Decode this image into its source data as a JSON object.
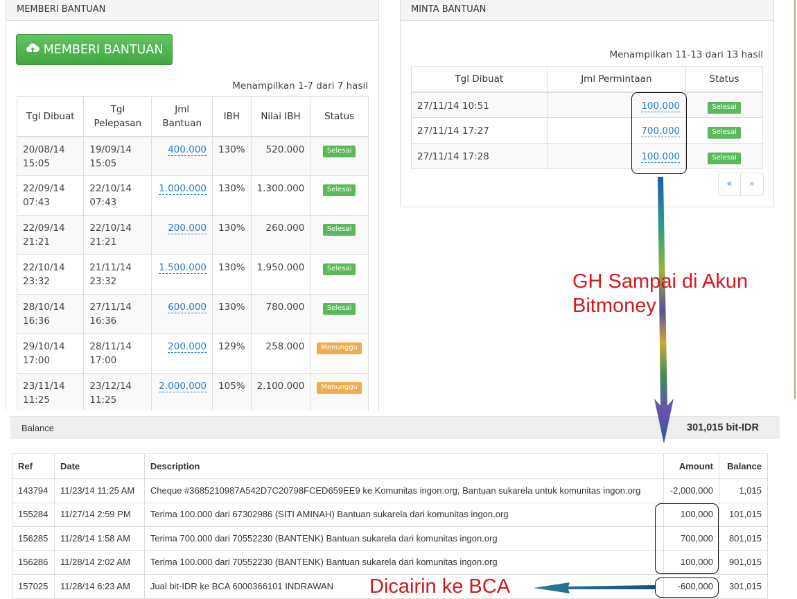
{
  "give_panel": {
    "title": "MEMBERI BANTUAN",
    "button_label": "MEMBERI BANTUAN",
    "result_count": "Menampilkan 1-7 dari 7 hasil",
    "headers": [
      "Tgl Dibuat",
      "Tgl\nPelepasan",
      "Jml\nBantuan",
      "IBH",
      "Nilai IBH",
      "Status"
    ],
    "rows": [
      {
        "created": "20/08/14\n15:05",
        "release": "19/09/14\n15:05",
        "amount": "400.000",
        "ibh": "130%",
        "value": "520.000",
        "status": "Selesai",
        "status_type": "done"
      },
      {
        "created": "22/09/14\n07:43",
        "release": "22/10/14\n07:43",
        "amount": "1.000.000",
        "ibh": "130%",
        "value": "1.300.000",
        "status": "Selesai",
        "status_type": "done"
      },
      {
        "created": "22/09/14\n21:21",
        "release": "22/10/14\n21:21",
        "amount": "200.000",
        "ibh": "130%",
        "value": "260.000",
        "status": "Selesai",
        "status_type": "done"
      },
      {
        "created": "22/10/14\n23:32",
        "release": "21/11/14\n23:32",
        "amount": "1.500.000",
        "ibh": "130%",
        "value": "1.950.000",
        "status": "Selesai",
        "status_type": "done"
      },
      {
        "created": "28/10/14\n16:36",
        "release": "27/11/14\n16:36",
        "amount": "600.000",
        "ibh": "130%",
        "value": "780.000",
        "status": "Selesai",
        "status_type": "done"
      },
      {
        "created": "29/10/14\n17:00",
        "release": "28/11/14\n17:00",
        "amount": "200.000",
        "ibh": "129%",
        "value": "258.000",
        "status": "Menunggu",
        "status_type": "wait"
      },
      {
        "created": "23/11/14\n11:25",
        "release": "23/12/14\n11:25",
        "amount": "2.000.000",
        "ibh": "105%",
        "value": "2.100.000",
        "status": "Menunggu",
        "status_type": "wait"
      }
    ]
  },
  "ask_panel": {
    "title": "MINTA BANTUAN",
    "result_count": "Menampilkan 11-13 dari 13 hasil",
    "headers": [
      "Tgl Dibuat",
      "Jml Permintaan",
      "Status"
    ],
    "rows": [
      {
        "created": "27/11/14 10:51",
        "amount": "100.000",
        "status": "Selesai"
      },
      {
        "created": "27/11/14 17:27",
        "amount": "700.000",
        "status": "Selesai"
      },
      {
        "created": "27/11/14 17:28",
        "amount": "100.000",
        "status": "Selesai"
      }
    ],
    "pager": {
      "prev": "«",
      "next": "»"
    }
  },
  "balance": {
    "label": "Balance",
    "value": "301,015 bit-IDR"
  },
  "transactions": {
    "headers": [
      "Ref",
      "Date",
      "Description",
      "Amount",
      "Balance"
    ],
    "rows": [
      {
        "ref": "143794",
        "date": "11/23/14 11:25 AM",
        "desc": "Cheque #3685210987A542D7C20798FCED659EE9 ke Komunitas ingon.org, Bantuan sukarela untuk komunitas ingon.org",
        "amount": "-2,000,000",
        "balance": "1,015"
      },
      {
        "ref": "155284",
        "date": "11/27/14 2:59 PM",
        "desc": "Terima 100.000 dari 67302986 (SITI AMINAH) Bantuan sukarela dari komunitas ingon.org",
        "amount": "100,000",
        "balance": "101,015"
      },
      {
        "ref": "156285",
        "date": "11/28/14 1:58 AM",
        "desc": "Terima 700.000 dari 70552230 (BANTENK) Bantuan sukarela dari komunitas ingon.org",
        "amount": "700,000",
        "balance": "801,015"
      },
      {
        "ref": "156286",
        "date": "11/28/14 2:02 AM",
        "desc": "Terima 100.000 dari 70552230 (BANTENK) Bantuan sukarela dari komunitas ingon.org",
        "amount": "100,000",
        "balance": "901,015"
      },
      {
        "ref": "157025",
        "date": "11/28/14 6:23 AM",
        "desc": "Jual bit-IDR ke BCA 6000366101 INDRAWAN",
        "amount": "-600,000",
        "balance": "301,015"
      }
    ]
  },
  "annotations": {
    "gh_text_line1": "GH Sampai di Akun",
    "gh_text_line2": "Bitmoney",
    "bca_text": "Dicairin ke BCA",
    "text_color": "#d4181f"
  }
}
